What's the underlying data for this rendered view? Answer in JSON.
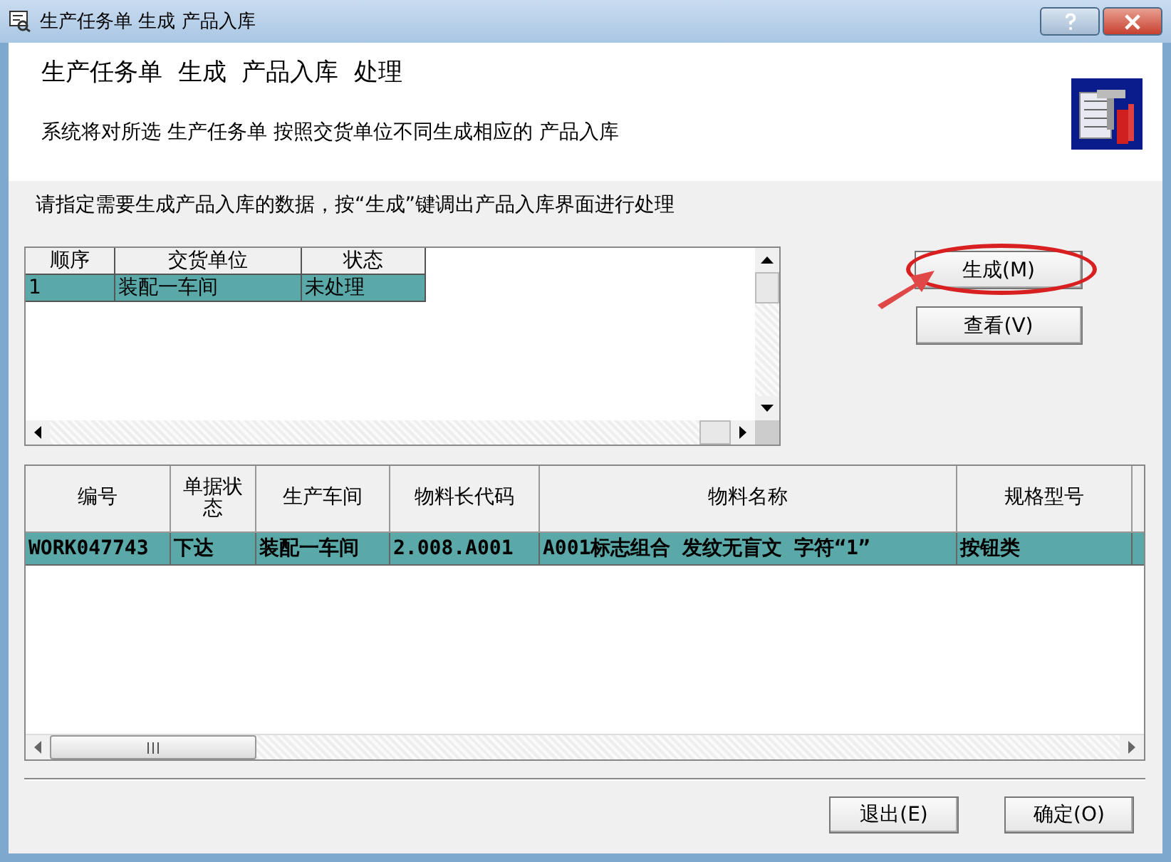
{
  "window": {
    "title": "生产任务单 生成 产品入库"
  },
  "header": {
    "title": "生产任务单  生成  产品入库  处理",
    "description": "系统将对所选 生产任务单 按照交货单位不同生成相应的 产品入库"
  },
  "instruction": "请指定需要生成产品入库的数据，按“生成”键调出产品入库界面进行处理",
  "units_table": {
    "columns": [
      "顺序",
      "交货单位",
      "状态"
    ],
    "rows": [
      {
        "cells": [
          "1",
          "装配一车间",
          "未处理"
        ],
        "selected": true
      }
    ]
  },
  "side_buttons": [
    {
      "label": "生成(M)",
      "highlighted": true
    },
    {
      "label": "查看(V)",
      "highlighted": false
    }
  ],
  "detail_table": {
    "columns": [
      "编号",
      "单据状态",
      "生产车间",
      "物料长代码",
      "物料名称",
      "规格型号"
    ],
    "rows": [
      {
        "cells": [
          "WORK047743",
          "下达",
          "装配一车间",
          "2.008.A001",
          "A001标志组合  发纹无盲文  字符“1”",
          "按钮类"
        ],
        "selected": true
      }
    ]
  },
  "footer_buttons": [
    {
      "label": "退出(E)"
    },
    {
      "label": "确定(O)"
    }
  ]
}
